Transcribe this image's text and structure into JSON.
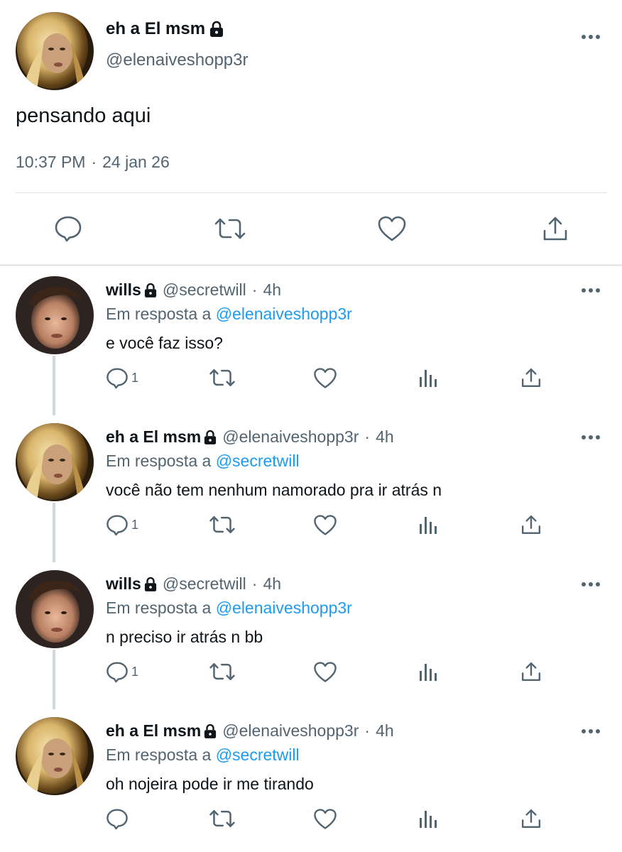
{
  "main_tweet": {
    "author_name": "eh a El msm",
    "handle": "@elenaiveshopp3r",
    "text": "pensando aqui",
    "time": "10:37 PM",
    "separator": "·",
    "date": "24 jan 26",
    "actions": [
      "reply-icon",
      "retweet-icon",
      "like-icon",
      "share-icon"
    ]
  },
  "replies": [
    {
      "author_name": "wills",
      "handle": "@secretwill",
      "separator": "·",
      "time": "4h",
      "reply_label": "Em resposta a",
      "reply_to": "@elenaiveshopp3r",
      "text": "e você faz isso?",
      "reply_count": "1"
    },
    {
      "author_name": "eh a El msm",
      "handle": "@elenaiveshopp3r",
      "separator": "·",
      "time": "4h",
      "reply_label": "Em resposta a",
      "reply_to": "@secretwill",
      "text": "você não tem nenhum namorado pra ir atrás n",
      "reply_count": "1"
    },
    {
      "author_name": "wills",
      "handle": "@secretwill",
      "separator": "·",
      "time": "4h",
      "reply_label": "Em resposta a",
      "reply_to": "@elenaiveshopp3r",
      "text": "n preciso ir atrás n bb",
      "reply_count": "1"
    },
    {
      "author_name": "eh a El msm",
      "handle": "@elenaiveshopp3r",
      "separator": "·",
      "time": "4h",
      "reply_label": "Em resposta a",
      "reply_to": "@secretwill",
      "text": "oh nojeira pode ir me tirando",
      "reply_count": ""
    }
  ],
  "colors": {
    "text": "#0f1419",
    "secondary": "#536471",
    "mention": "#1d9bf0",
    "divider": "#dfe4e8"
  }
}
